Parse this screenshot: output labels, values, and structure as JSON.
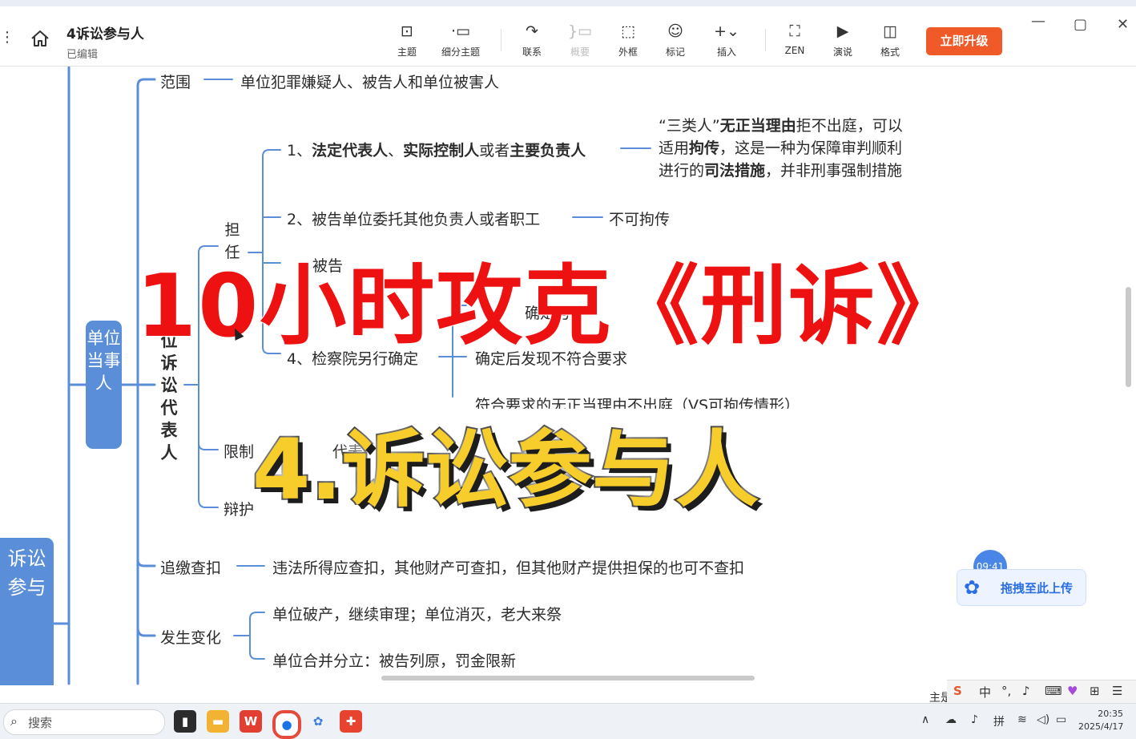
{
  "window": {
    "title": "4诉讼参与人",
    "subtitle": "已编辑",
    "upgrade_label": "立即升级"
  },
  "toolbar": [
    {
      "icon": "topic-icon",
      "glyph": "⊡",
      "label": "主题",
      "enabled": true
    },
    {
      "icon": "subtopic-icon",
      "glyph": "·▭",
      "label": "细分主题",
      "enabled": true
    },
    {
      "icon": "relation-icon",
      "glyph": "↷",
      "label": "联系",
      "enabled": true
    },
    {
      "icon": "summary-icon",
      "glyph": "}▭",
      "label": "概要",
      "enabled": false
    },
    {
      "icon": "boundary-icon",
      "glyph": "⬚",
      "label": "外框",
      "enabled": true
    },
    {
      "icon": "marker-icon",
      "glyph": "☺",
      "label": "标记",
      "enabled": true
    },
    {
      "icon": "insert-icon",
      "glyph": "+⌄",
      "label": "插入",
      "enabled": true
    },
    {
      "icon": "zen-icon",
      "glyph": "⛶",
      "label": "ZEN",
      "enabled": true
    },
    {
      "icon": "pitch-icon",
      "glyph": "▶",
      "label": "演说",
      "enabled": true
    },
    {
      "icon": "format-icon",
      "glyph": "◫",
      "label": "格式",
      "enabled": true
    }
  ],
  "mindmap": {
    "root_label": "诉讼参与",
    "branch_label": "单位当事人",
    "scope": {
      "label": "范围",
      "value": "单位犯罪嫌疑人、被告人和单位被害人"
    },
    "rep": {
      "label": "单位诉讼代表人",
      "serve_label": "担任",
      "item1_pre": "1、",
      "item1_b1": "法定代表人",
      "item1_sep1": "、",
      "item1_b2": "实际控制人",
      "item1_mid": "或者",
      "item1_b3": "主要负责人",
      "note_l1_a": "“三类人”",
      "note_l1_b": "无正当理由",
      "note_l1_c": "拒不出庭，可以",
      "note_l2_a": "适用",
      "note_l2_b": "拘传",
      "note_l2_c": "，这是一种为保障审判顺利",
      "note_l3_a": "进行的",
      "note_l3_b": "司法措施",
      "note_l3_c": "，并非刑事强制措施",
      "item2": "2、被告单位委托其他负责人或者职工",
      "item2_result": "不可拘传",
      "item3_partial": "被告",
      "item3_sub_partial": "确定与",
      "item4": "4、检察院另行确定",
      "item4_result": "确定后发现不符合要求",
      "item4_sub2": "符合要求的无正当理由不出庭（VS可拘传情形）",
      "limit_partial": "限制",
      "limit_tail": "代表",
      "defense_partial": "辩护"
    },
    "recover": {
      "label": "追缴查扣",
      "value": "违法所得应查扣，其他财产可查扣，但其他财产提供担保的也可不查扣"
    },
    "change": {
      "label": "发生变化",
      "item1": "单位破产，继续审理；单位消灭，老大来祭",
      "item2": "单位合并分立：被告列原，罚金限新"
    }
  },
  "overlay": {
    "headline": "10小时攻克《刑诉》",
    "subtitle": "4.诉讼参与人"
  },
  "upload": {
    "label": "拖拽至此上传",
    "time": "09:41"
  },
  "ime": {
    "lang": "中",
    "partial_label": "主是"
  },
  "taskbar": {
    "search_placeholder": "搜索",
    "apps": [
      "explorer",
      "wps",
      "chrome",
      "xmind",
      "app"
    ],
    "time": "20:35",
    "date": "2025/4/17"
  },
  "colors": {
    "branch_blue": "#5b8ed8",
    "headline_red": "#ee1111",
    "subtitle_yellow": "#f7cd2c",
    "upgrade_orange": "#f05a28"
  }
}
